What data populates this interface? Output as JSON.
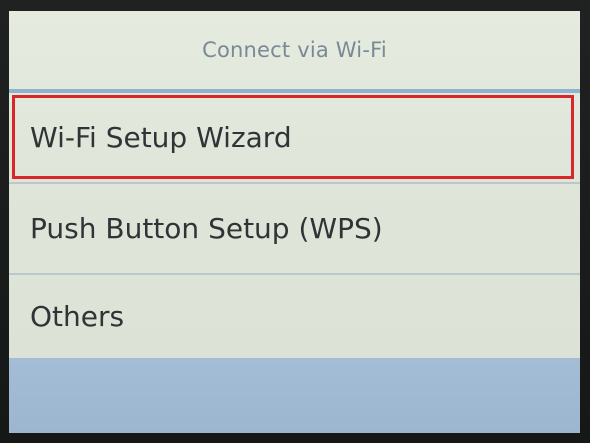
{
  "header": {
    "title": "Connect via Wi-Fi"
  },
  "menu": {
    "items": [
      {
        "label": "Wi-Fi Setup Wizard",
        "selected": true
      },
      {
        "label": "Push Button Setup (WPS)",
        "selected": false
      },
      {
        "label": "Others",
        "selected": false
      }
    ]
  },
  "colors": {
    "selection_border": "#d9262a",
    "header_rule": "#8fb2cf",
    "footer_bar": "#a4bdd6"
  }
}
